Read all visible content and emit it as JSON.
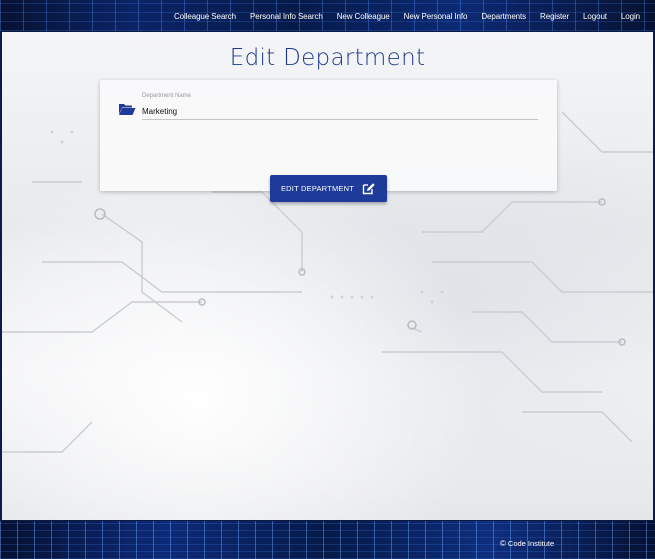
{
  "navbar": {
    "links": [
      {
        "label": "Colleague Search"
      },
      {
        "label": "Personal Info Search"
      },
      {
        "label": "New Colleague"
      },
      {
        "label": "New Personal Info"
      },
      {
        "label": "Departments"
      },
      {
        "label": "Register"
      },
      {
        "label": "Logout"
      },
      {
        "label": "Login"
      }
    ]
  },
  "main": {
    "title": "Edit Department",
    "form": {
      "field_label": "Department Name",
      "field_value": "Marketing",
      "submit_label": "EDIT DEPARTMENT"
    }
  },
  "footer": {
    "credit": "Code Institute"
  },
  "colors": {
    "brand_blue": "#1e3b9a",
    "title_blue": "#1f3a8f",
    "nav_background": "#0b2466"
  },
  "icons": {
    "field": "folder-open-icon",
    "button": "edit-icon",
    "footer": "copyright-icon"
  }
}
